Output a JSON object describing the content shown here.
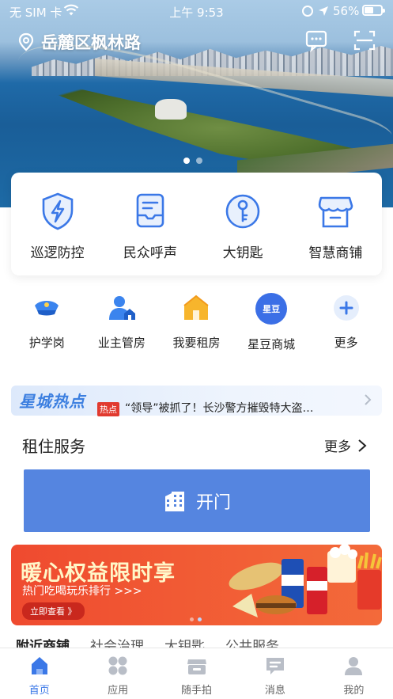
{
  "status_bar": {
    "carrier": "无 SIM 卡",
    "time": "上午 9:53",
    "battery": "56%",
    "battery_level": 0.56
  },
  "header": {
    "location": "岳麓区枫林路",
    "icons": [
      "message-icon",
      "scan-icon"
    ],
    "banner_slides": 2,
    "banner_active": 1
  },
  "main_services": [
    {
      "label": "巡逻防控",
      "icon": "shield-lightning-icon"
    },
    {
      "label": "民众呼声",
      "icon": "inbox-message-icon"
    },
    {
      "label": "大钥匙",
      "icon": "key-icon"
    },
    {
      "label": "智慧商铺",
      "icon": "storefront-icon"
    }
  ],
  "sub_services": [
    {
      "label": "护学岗",
      "icon": "police-cap-icon"
    },
    {
      "label": "业主管房",
      "icon": "owner-house-icon"
    },
    {
      "label": "我要租房",
      "icon": "rent-house-icon"
    },
    {
      "label": "星豆商城",
      "icon": "star-bean-bag-icon",
      "icon_text": "星豆"
    },
    {
      "label": "更多",
      "icon": "plus-icon"
    }
  ],
  "news": {
    "brand": "星城热点",
    "tag": "热点",
    "headline": "“领导”被抓了！长沙警方摧毁特大盗…"
  },
  "rental": {
    "title": "租住服务",
    "more": "更多",
    "open_button": "开门"
  },
  "promo": {
    "title": "暖心权益限时享",
    "subtitle": "热门吃喝玩乐排行 >>>",
    "button": "立即查看 》",
    "slides": 2,
    "active": 2
  },
  "tabs": [
    "附近商铺",
    "社会治理",
    "大钥匙",
    "公共服务"
  ],
  "bottom_nav": [
    {
      "label": "首页",
      "icon": "home-icon",
      "active": true
    },
    {
      "label": "应用",
      "icon": "apps-grid-icon",
      "active": false
    },
    {
      "label": "随手拍",
      "icon": "camera-store-icon",
      "active": false
    },
    {
      "label": "消息",
      "icon": "message-icon",
      "active": false
    },
    {
      "label": "我的",
      "icon": "profile-icon",
      "active": false
    }
  ],
  "colors": {
    "accent": "#3b78e7",
    "open_button": "#5585e0",
    "promo_red": "#f15a34",
    "hot_tag": "#e13a2f"
  }
}
